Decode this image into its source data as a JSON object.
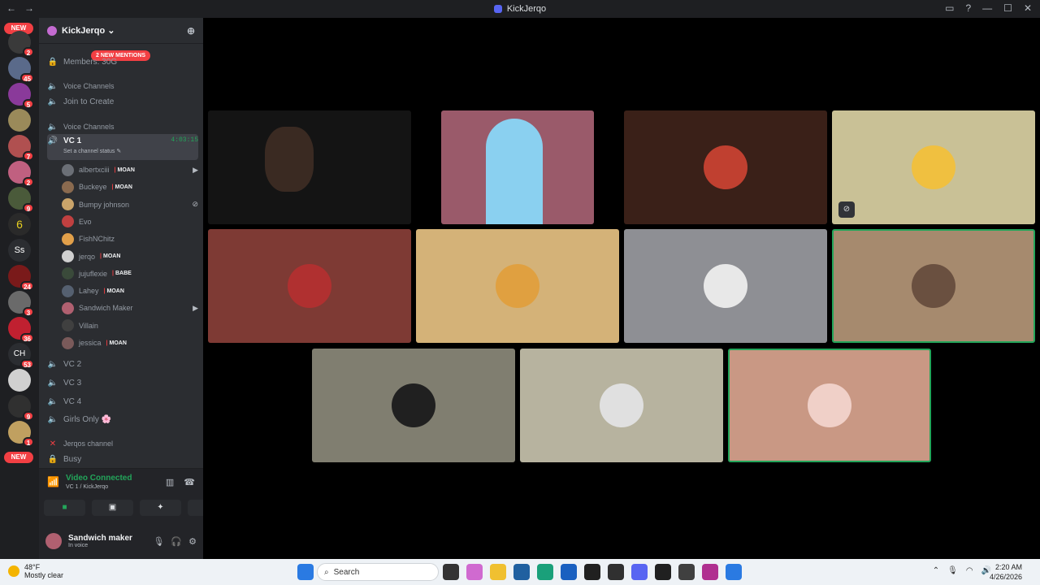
{
  "window": {
    "title": "KickJerqo",
    "back": "←",
    "forward": "→"
  },
  "server": {
    "name": "KickJerqo ⌄",
    "new_mentions": "2 NEW MENTIONS",
    "members_label": "Members: 30G"
  },
  "guild_badges": [
    {
      "label": "NEW"
    },
    {
      "count": "2"
    },
    {
      "count": "45"
    },
    {
      "count": "5"
    },
    {
      "count": ""
    },
    {
      "count": "7"
    },
    {
      "count": "2"
    },
    {
      "count": "9"
    },
    {
      "label": "Ss"
    },
    {
      "count": "24"
    },
    {
      "count": "3"
    },
    {
      "count": "36"
    },
    {
      "label": "CH",
      "count": "53"
    },
    {
      "count": ""
    },
    {
      "count": "9"
    },
    {
      "count": "1"
    },
    {
      "label": "NEW"
    }
  ],
  "channels": {
    "cat1": "Voice Channels",
    "join_to_create": "Join to Create",
    "cat2": "Voice Channels",
    "vc1": "VC 1",
    "vc1_timer": "4:03:15",
    "vc1_status": "Set a channel status ✎",
    "vc2": "VC 2",
    "vc3": "VC 3",
    "vc4": "VC 4",
    "girls_only": "Girls Only 🌸",
    "cat3": "Jerqos channel",
    "busy": "Busy"
  },
  "members": [
    {
      "name": "albertxciii",
      "tag": "MOAN",
      "right": "▶",
      "color": "#6b6f76"
    },
    {
      "name": "Buckeye",
      "tag": "MOAN",
      "right": "",
      "color": "#8a6a4f"
    },
    {
      "name": "Bumpy johnson",
      "tag": "",
      "right": "⊘",
      "color": "#caa46a"
    },
    {
      "name": "Evo",
      "tag": "",
      "right": "",
      "color": "#c04040"
    },
    {
      "name": "FishNChitz",
      "tag": "",
      "right": "",
      "color": "#e2a04a"
    },
    {
      "name": "jerqo",
      "tag": "MOAN",
      "right": "",
      "color": "#d0d0d0"
    },
    {
      "name": "jujuflexie",
      "tag": "BABE",
      "right": "",
      "color": "#3a4a3a"
    },
    {
      "name": "Lahey",
      "tag": "MOAN",
      "right": "",
      "color": "#556070"
    },
    {
      "name": "Sandwich Maker",
      "tag": "",
      "right": "▶",
      "color": "#b06070"
    },
    {
      "name": "Villain",
      "tag": "",
      "right": "",
      "color": "#404040"
    },
    {
      "name": "jessica",
      "tag": "MOAN",
      "right": "",
      "color": "#7a5a5a"
    }
  ],
  "voice_panel": {
    "status": "Video Connected",
    "location": "VC 1 / KickJerqo",
    "btn_camera": "■",
    "btn_screen": "▣",
    "btn_activities": "✦",
    "btn_soundboard": "♪"
  },
  "user": {
    "name": "Sandwich maker",
    "status": "In voice"
  },
  "tiles_colors": {
    "t3": "#3a2018",
    "t4": "#c9c196",
    "t5": "#7e3a34",
    "t6": "#d4b278",
    "t7": "#8e8f94",
    "t8": "#a68a6e",
    "t9": "#807e70",
    "t10": "#b7b39f",
    "t11": "#c99884"
  },
  "taskbar": {
    "temp": "48°F",
    "weather": "Mostly clear",
    "search": "Search",
    "time": "2:20 AM",
    "date": "4/26/2026"
  }
}
